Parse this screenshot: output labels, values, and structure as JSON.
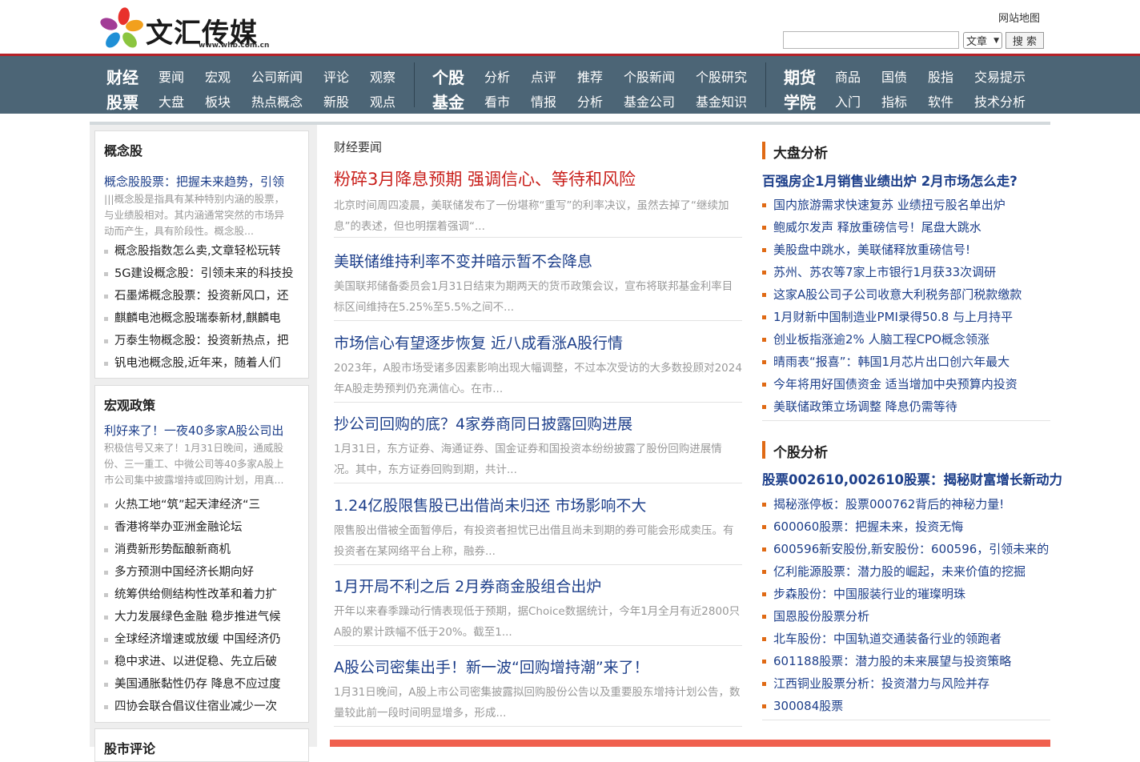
{
  "header": {
    "brand": "文汇传媒",
    "url": "www.whb.com.cn",
    "sitemap": "网站地图",
    "search_placeholder": "",
    "search_select": "文章",
    "search_button": "搜 索"
  },
  "nav": {
    "groups": [
      {
        "row1": [
          "财经",
          "要闻",
          "宏观",
          "公司新闻",
          "评论",
          "观察"
        ],
        "row2": [
          "股票",
          "大盘",
          "板块",
          "热点概念",
          "新股",
          "观点"
        ]
      },
      {
        "row1": [
          "个股",
          "分析",
          "点评",
          "推荐",
          "个股新闻",
          "个股研究"
        ],
        "row2": [
          "基金",
          "看市",
          "情报",
          "分析",
          "基金公司",
          "基金知识"
        ]
      },
      {
        "row1": [
          "期货",
          "商品",
          "国债",
          "股指",
          "交易提示"
        ],
        "row2": [
          "学院",
          "入门",
          "指标",
          "软件",
          "技术分析"
        ]
      }
    ]
  },
  "left": {
    "concept": {
      "title": "概念股",
      "lead": "概念股股票：把握未来趋势，引领",
      "desc": "|||概念股是指具有某种特别内涵的股票，与业绩股相对。其内涵通常突然的市场异动而产生，具有阶段性。概念股...",
      "items": [
        "概念股指数怎么卖,文章轻松玩转",
        "5G建设概念股：引领未来的科技投",
        "石墨烯概念股票：投资新风口，还",
        "麒麟电池概念股瑞泰新材,麒麟电",
        "万泰生物概念股：投资新热点，把",
        "钒电池概念股,近年来，随着人们"
      ]
    },
    "macro": {
      "title": "宏观政策",
      "lead": "利好来了！一夜40多家A股公司出",
      "desc": "积极信号又来了！1月31日晚间，通威股份、三一重工、中微公司等40多家A股上市公司集中披露增持或回购计划，用真...",
      "items": [
        "火热工地“筑”起天津经济“三",
        "香港将举办亚洲金融论坛",
        "消费新形势酝酿新商机",
        "多方预测中国经济长期向好",
        "统筹供给侧结构性改革和着力扩",
        "大力发展绿色金融 稳步推进气候",
        "全球经济增速或放缓 中国经济仍",
        "稳中求进、以进促稳、先立后破",
        "美国通胀黏性仍存 降息不应过度",
        "四协会联合倡议住宿业减少一次"
      ]
    },
    "market": {
      "title": "股市评论"
    }
  },
  "center": {
    "title": "财经要闻",
    "articles": [
      {
        "title": "粉碎3月降息预期 强调信心、等待和风险",
        "desc": "北京时间周四凌晨，美联储发布了一份堪称“重写”的利率决议，虽然去掉了“继续加息”的表述，但也明摆着强调“..."
      },
      {
        "title": "美联储维持利率不变并暗示暂不会降息",
        "desc": "美国联邦储备委员会1月31日结束为期两天的货币政策会议，宣布将联邦基金利率目标区间维持在5.25%至5.5%之间不..."
      },
      {
        "title": "市场信心有望逐步恢复 近八成看涨A股行情",
        "desc": "2023年，A股市场受诸多因素影响出现大幅调整，不过本次受访的大多数投顾对2024年A股走势预判仍充满信心。在市..."
      },
      {
        "title": "抄公司回购的底？4家券商同日披露回购进展",
        "desc": "1月31日，东方证券、海通证券、国金证券和国投资本纷纷披露了股份回购进展情况。其中，东方证券回购到期，共计..."
      },
      {
        "title": "1.24亿股限售股已出借尚未归还 市场影响不大",
        "desc": "限售股出借被全面暂停后，有投资者担忧已出借且尚未到期的券可能会形成卖压。有投资者在某网络平台上称，融券..."
      },
      {
        "title": "1月开局不利之后 2月券商金股组合出炉",
        "desc": "开年以来春季躁动行情表现低于预期，据Choice数据统计，今年1月全月有近2800只A股的累计跌幅不低于20%。截至1..."
      },
      {
        "title": "A股公司密集出手！新一波“回购增持潮”来了！",
        "desc": "1月31日晚间，A股上市公司密集披露拟回购股份公告以及重要股东增持计划公告，数量较此前一段时间明显增多，形成..."
      }
    ]
  },
  "right": {
    "market": {
      "title": "大盘分析",
      "lead": "百强房企1月销售业绩出炉 2月市场怎么走?",
      "items": [
        "国内旅游需求快速复苏 业绩扭亏股名单出炉",
        "鲍威尔发声 释放重磅信号！尾盘大跳水",
        "美股盘中跳水，美联储释放重磅信号!",
        "苏州、苏农等7家上市银行1月获33次调研",
        "这家A股公司子公司收意大利税务部门税款缴款",
        "1月财新中国制造业PMI录得50.8 与上月持平",
        "创业板指涨逾2% 人脑工程CPO概念领涨",
        "晴雨表“报喜”：韩国1月芯片出口创六年最大",
        "今年将用好国债资金 适当增加中央预算内投资",
        "美联储政策立场调整 降息仍需等待"
      ]
    },
    "stock": {
      "title": "个股分析",
      "lead": "股票002610,002610股票：揭秘财富增长新动力",
      "items": [
        "揭秘涨停板：股票000762背后的神秘力量!",
        "600060股票：把握未来，投资无悔",
        "600596新安股份,新安股份：600596，引领未来的",
        "亿利能源股票：潜力股的崛起，未来价值的挖掘",
        "步森股份：中国服装行业的璀璨明珠",
        "国恩股份股票分析",
        "北车股份：中国轨道交通装备行业的领跑者",
        "601188股票：潜力股的未来展望与投资策略",
        "江西铜业股票分析：投资潜力与风险并存",
        "300084股票"
      ]
    }
  },
  "colors": {
    "nav_bg": "#4c6576",
    "accent_red": "#b62027",
    "link_blue": "#1d3f8a",
    "orange": "#e06a15"
  }
}
